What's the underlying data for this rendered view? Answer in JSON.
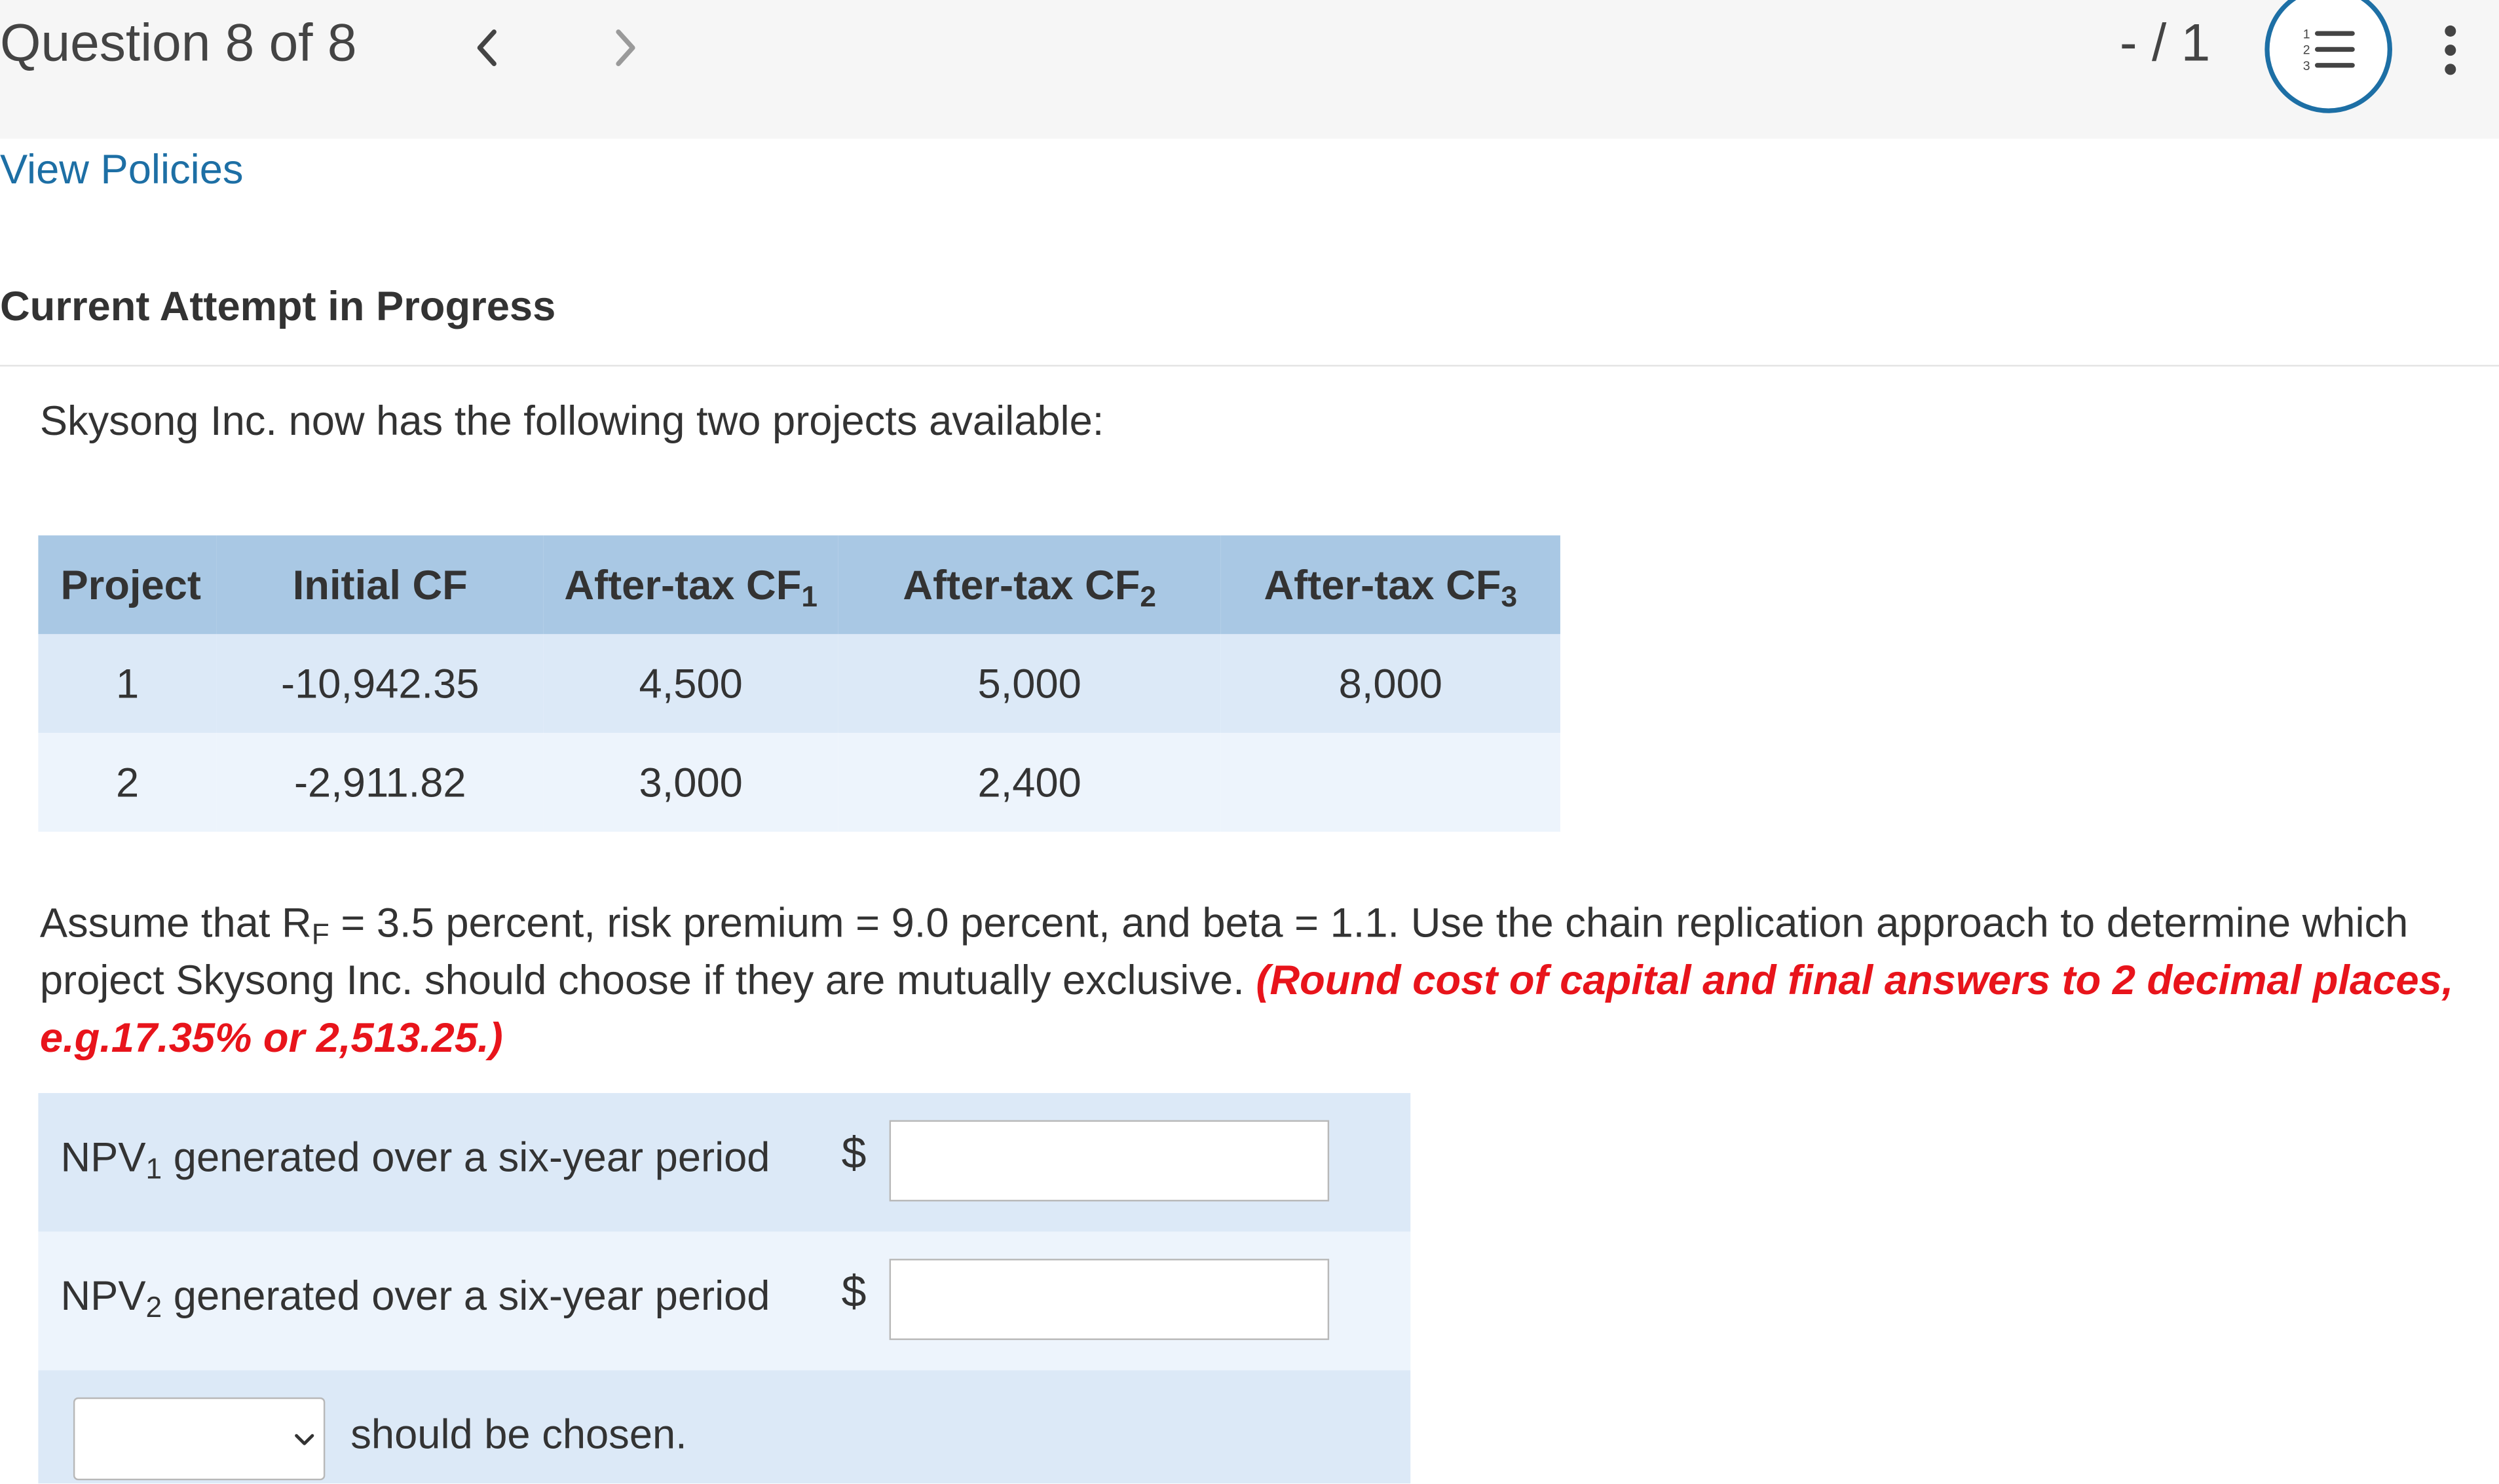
{
  "header": {
    "question_label": "Question 8 of 8",
    "prev_glyph": "<",
    "next_glyph": ">",
    "score": "- / 1",
    "list_icon": "numbered-list-icon",
    "more_icon": "more-vertical-icon"
  },
  "links": {
    "policies": "View Policies"
  },
  "status": {
    "attempt": "Current Attempt in Progress"
  },
  "question": {
    "intro": "Skysong Inc. now has the following two projects available:",
    "table": {
      "headers": {
        "project": "Project",
        "initial": "Initial CF",
        "cf1": "After-tax CF",
        "cf1_sub": "1",
        "cf2": "After-tax CF",
        "cf2_sub": "2",
        "cf3": "After-tax CF",
        "cf3_sub": "3"
      },
      "rows": [
        {
          "project": "1",
          "initial": "-10,942.35",
          "cf1": "4,500",
          "cf2": "5,000",
          "cf3": "8,000"
        },
        {
          "project": "2",
          "initial": "-2,911.82",
          "cf1": "3,000",
          "cf2": "2,400",
          "cf3": ""
        }
      ]
    },
    "assume_pre": "Assume that R",
    "assume_sub": "F",
    "assume_post": " = 3.5 percent, risk premium = 9.0 percent, and beta = 1.1. Use the chain replication approach to determine which project Skysong Inc. should choose if they are mutually exclusive. ",
    "instruction": "(Round cost of capital and final answers to 2 decimal places, e.g.17.35% or 2,513.25.)"
  },
  "answers": {
    "npv1": {
      "label_main": "NPV",
      "label_sub": "1",
      "label_rest": " generated over a six-year period",
      "currency": "$",
      "value": ""
    },
    "npv2": {
      "label_main": "NPV",
      "label_sub": "2",
      "label_rest": " generated over a six-year period",
      "currency": "$",
      "value": ""
    },
    "choice": {
      "selected": "",
      "suffix": "should be chosen."
    }
  },
  "colors": {
    "accent": "#1d6fa5",
    "table_header": "#a9c8e4",
    "row_dark": "#dce9f7",
    "row_light": "#edf4fc",
    "instruction": "#e8141b"
  }
}
